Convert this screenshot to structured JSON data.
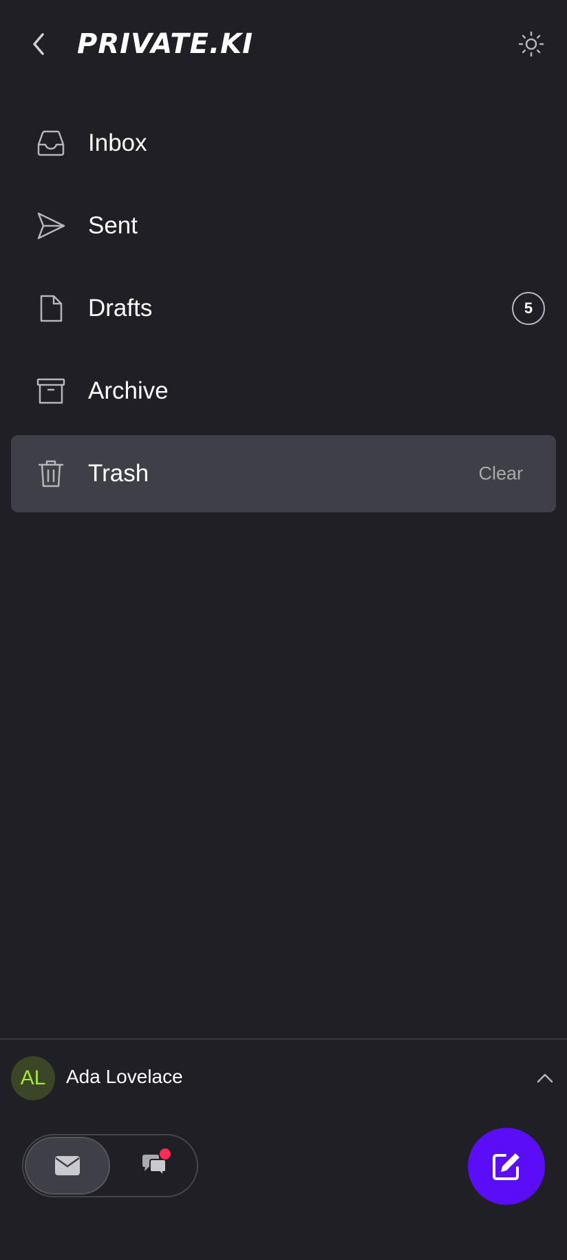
{
  "header": {
    "logo_text": "PRIVATE.KI",
    "back_icon": "chevron-left-icon",
    "theme_icon": "sun-icon"
  },
  "folders": [
    {
      "label": "Inbox",
      "icon": "inbox-icon"
    },
    {
      "label": "Sent",
      "icon": "send-icon"
    },
    {
      "label": "Drafts",
      "icon": "document-icon",
      "badge": "5"
    },
    {
      "label": "Archive",
      "icon": "archive-icon"
    },
    {
      "label": "Trash",
      "icon": "trash-icon",
      "action": "Clear",
      "active": true
    }
  ],
  "account": {
    "initials": "AL",
    "name": "Ada Lovelace",
    "avatar_bg": "#3a4625",
    "avatar_fg": "#a8e63a"
  },
  "switcher": {
    "selected": "mail",
    "chat_has_notification": true
  },
  "colors": {
    "background": "#1f1f25",
    "active_row": "#3f3f47",
    "accent": "#5b0ef5",
    "notification": "#ff2d55"
  }
}
